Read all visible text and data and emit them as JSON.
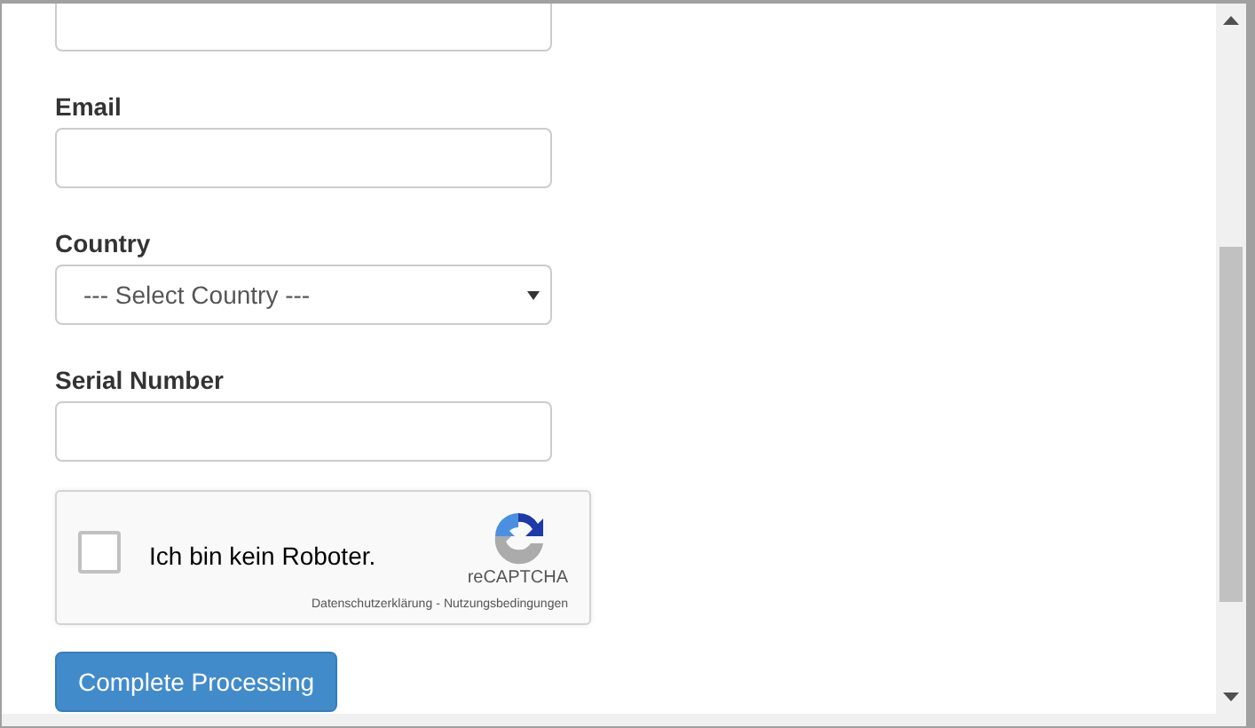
{
  "fields": [
    {
      "kind": "text"
    },
    {
      "kind": "text",
      "label": "Email"
    },
    {
      "kind": "select",
      "label": "Country",
      "value": "--- Select Country ---"
    },
    {
      "kind": "text",
      "label": "Serial Number"
    }
  ],
  "captcha": {
    "checked": false,
    "label": "Ich bin kein Roboter.",
    "brand": "reCAPTCHA",
    "privacy_link": "Datenschutzerklärung",
    "separator": "-",
    "terms_link": "Nutzungsbedingungen"
  },
  "submit_button": "Complete Processing"
}
